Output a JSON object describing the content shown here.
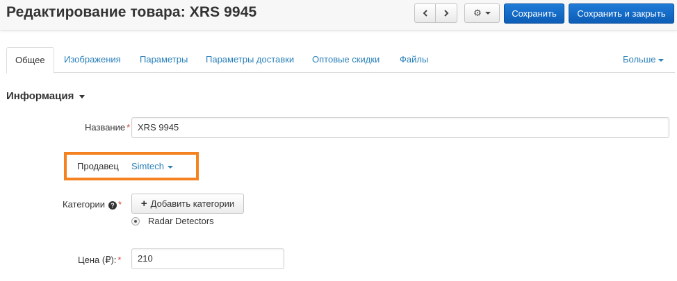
{
  "header": {
    "title": "Редактирование товара: XRS 9945",
    "prev_icon": "chevron-left-icon",
    "next_icon": "chevron-right-icon",
    "settings_icon": "gear-icon",
    "save_label": "Сохранить",
    "save_close_label": "Сохранить и закрыть"
  },
  "tabs": [
    {
      "label": "Общее",
      "active": true
    },
    {
      "label": "Изображения"
    },
    {
      "label": "Параметры"
    },
    {
      "label": "Параметры доставки"
    },
    {
      "label": "Оптовые скидки"
    },
    {
      "label": "Файлы"
    }
  ],
  "tabs_more": "Больше",
  "section": {
    "title": "Информация"
  },
  "form": {
    "name_label": "Название",
    "name_value": "XRS 9945",
    "vendor_label": "Продавец",
    "vendor_value": "Simtech",
    "categories_label": "Категории",
    "help_icon": "question-circle-icon",
    "add_categories_label": "Добавить категории",
    "category_item": "Radar Detectors",
    "price_label": "Цена (₽):",
    "price_value": "210",
    "required_marker": "*"
  },
  "colors": {
    "accent": "#2a80b9",
    "primary_button": "#0c5db6",
    "highlight": "#f58220",
    "required": "#d0453b"
  }
}
